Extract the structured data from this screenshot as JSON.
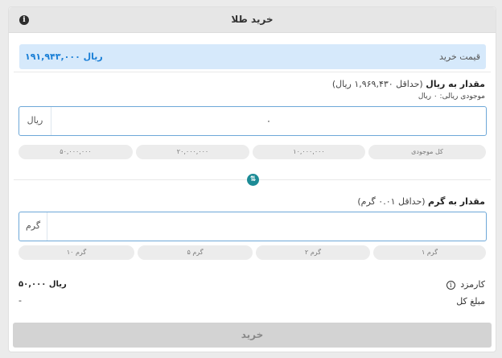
{
  "header": {
    "title": "خرید طلا",
    "info_icon": "i"
  },
  "price": {
    "label": "قیمت خرید",
    "value": "۱۹۱,۹۴۳,۰۰۰ ریال"
  },
  "rial_section": {
    "title": "مقدار به ریال",
    "min_note": "(حداقل ۱,۹۶۹,۴۳۰ ریال)",
    "balance": "موجودی ریالی: ۰ ریال",
    "unit": "ریال",
    "value": "۰",
    "presets": [
      "کل موجودی",
      "۱۰,۰۰۰,۰۰۰",
      "۲۰,۰۰۰,۰۰۰",
      "۵۰,۰۰۰,۰۰۰"
    ]
  },
  "swap_icon": "⇅",
  "gram_section": {
    "title": "مقدار به گرم",
    "min_note": "(حداقل ۰.۰۱ گرم)",
    "unit": "گرم",
    "value": "",
    "presets": [
      "۱ گرم",
      "۲ گرم",
      "۵ گرم",
      "۱۰ گرم"
    ]
  },
  "summary": {
    "fee_label": "کارمزد",
    "fee_value": "۵۰,۰۰۰ ریال",
    "total_label": "مبلغ کل",
    "total_value": "-"
  },
  "buy_button": "خرید"
}
